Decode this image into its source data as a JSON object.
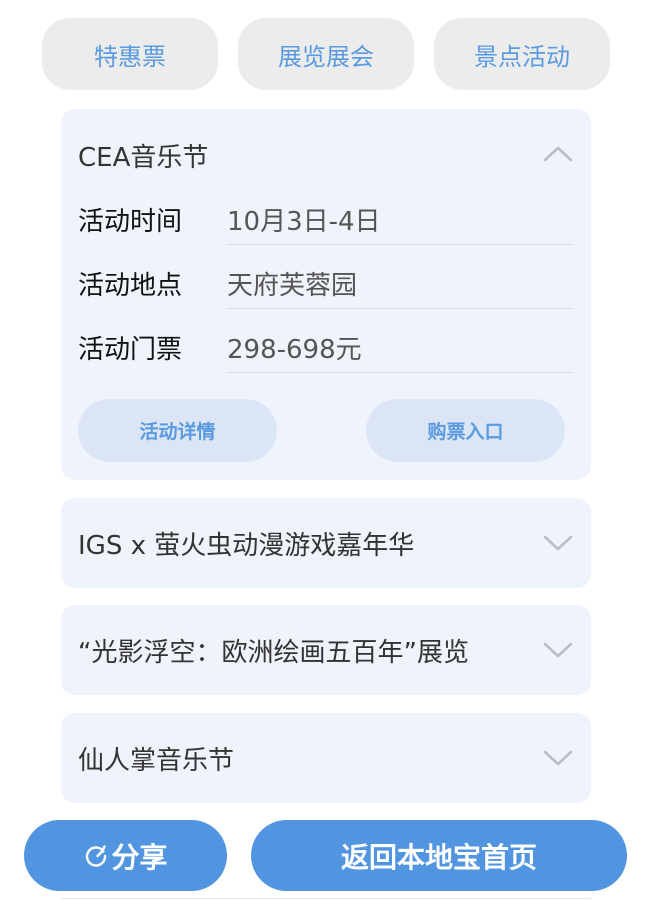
{
  "tabs": [
    {
      "label": "特惠票"
    },
    {
      "label": "展览展会"
    },
    {
      "label": "景点活动"
    }
  ],
  "events": [
    {
      "title": "CEA音乐节",
      "expanded": true,
      "chevron_icon": "chevron-up-icon",
      "details": [
        {
          "label": "活动时间",
          "value": "10月3日-4日"
        },
        {
          "label": "活动地点",
          "value": "天府芙蓉园"
        },
        {
          "label": "活动门票",
          "value": "298-698元"
        }
      ],
      "buttons": {
        "details": "活动详情",
        "tickets": "购票入口"
      }
    },
    {
      "title": "IGS x 萤火虫动漫游戏嘉年华",
      "expanded": false,
      "chevron_icon": "chevron-down-icon"
    },
    {
      "title": "“光影浮空：欧洲绘画五百年”展览",
      "expanded": false,
      "chevron_icon": "chevron-down-icon"
    },
    {
      "title": "仙人掌音乐节",
      "expanded": false,
      "chevron_icon": "chevron-down-icon"
    }
  ],
  "actions": {
    "share": "分享",
    "share_icon": "share-refresh-icon",
    "home": "返回本地宝首页"
  },
  "colors": {
    "accent": "#5195e0",
    "tab_text": "#5a9ae0",
    "card_bg": "#eff3fb",
    "tab_bg": "#ececec",
    "secondary_button_bg": "#dbe5f6"
  }
}
